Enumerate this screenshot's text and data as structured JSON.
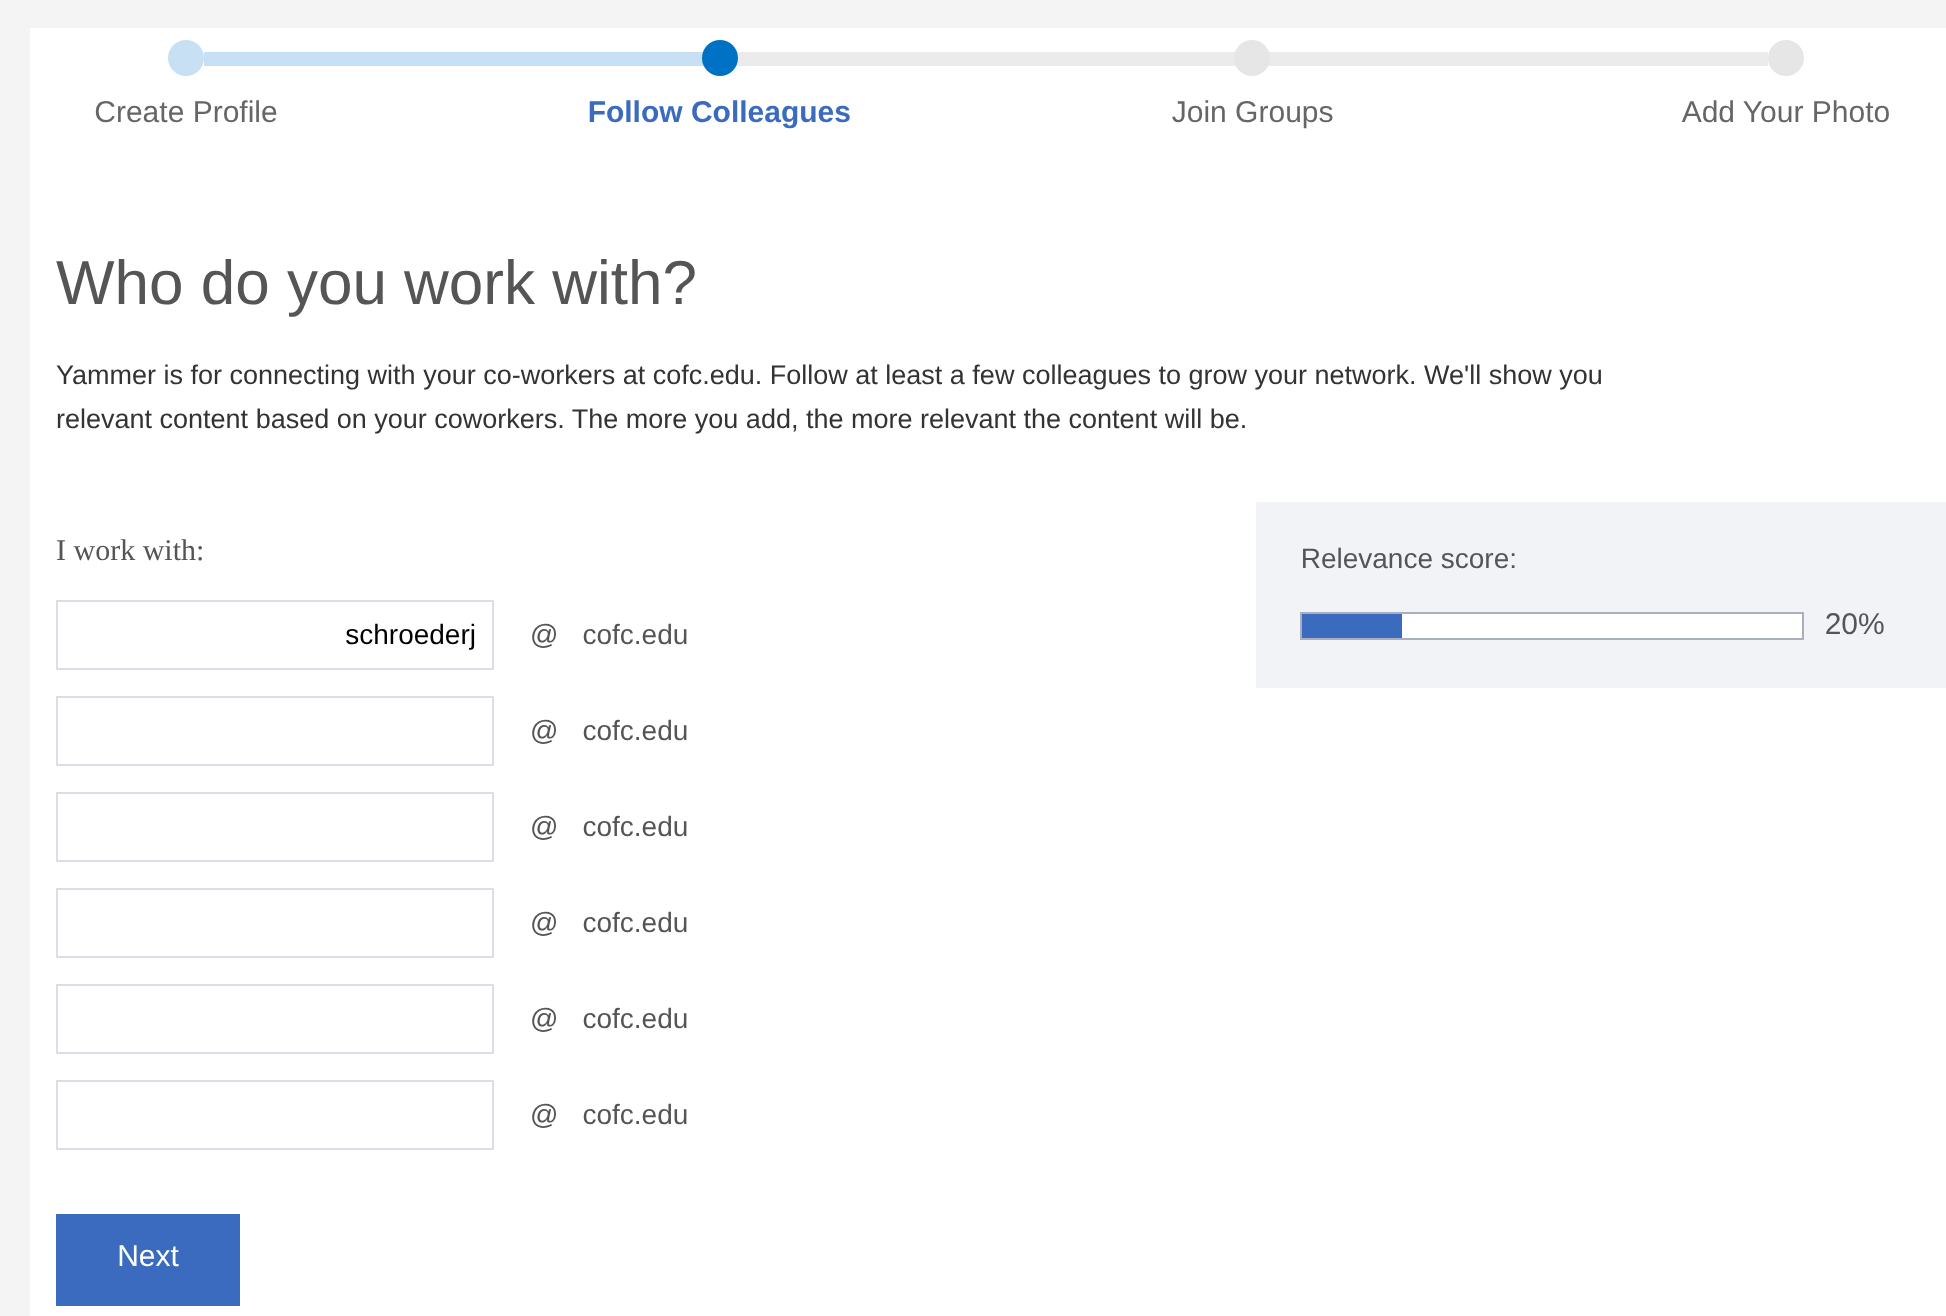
{
  "steps": [
    {
      "label": "Create Profile",
      "completed": true,
      "selected": false
    },
    {
      "label": "Follow Colleagues",
      "completed": false,
      "selected": true
    },
    {
      "label": "Join Groups",
      "completed": false,
      "selected": false
    },
    {
      "label": "Add Your Photo",
      "completed": false,
      "selected": false
    }
  ],
  "heading": "Who do you work with?",
  "description": "Yammer is for connecting with your co-workers at cofc.edu. Follow at least a few colleagues to grow your network. We'll show you relevant content based on your coworkers. The more you add, the more relevant the content will be.",
  "colleagues_label": "I work with:",
  "colleagues": [
    {
      "value": "schroederj",
      "at": "@",
      "domain": "cofc.edu"
    },
    {
      "at": "@",
      "domain": "cofc.edu"
    },
    {
      "at": "@",
      "domain": "cofc.edu"
    },
    {
      "at": "@",
      "domain": "cofc.edu"
    },
    {
      "at": "@",
      "domain": "cofc.edu"
    },
    {
      "at": "@",
      "domain": "cofc.edu"
    }
  ],
  "relevance": {
    "label": "Relevance score:",
    "level": 0.2,
    "reading": "20%"
  },
  "next_button": "Next"
}
